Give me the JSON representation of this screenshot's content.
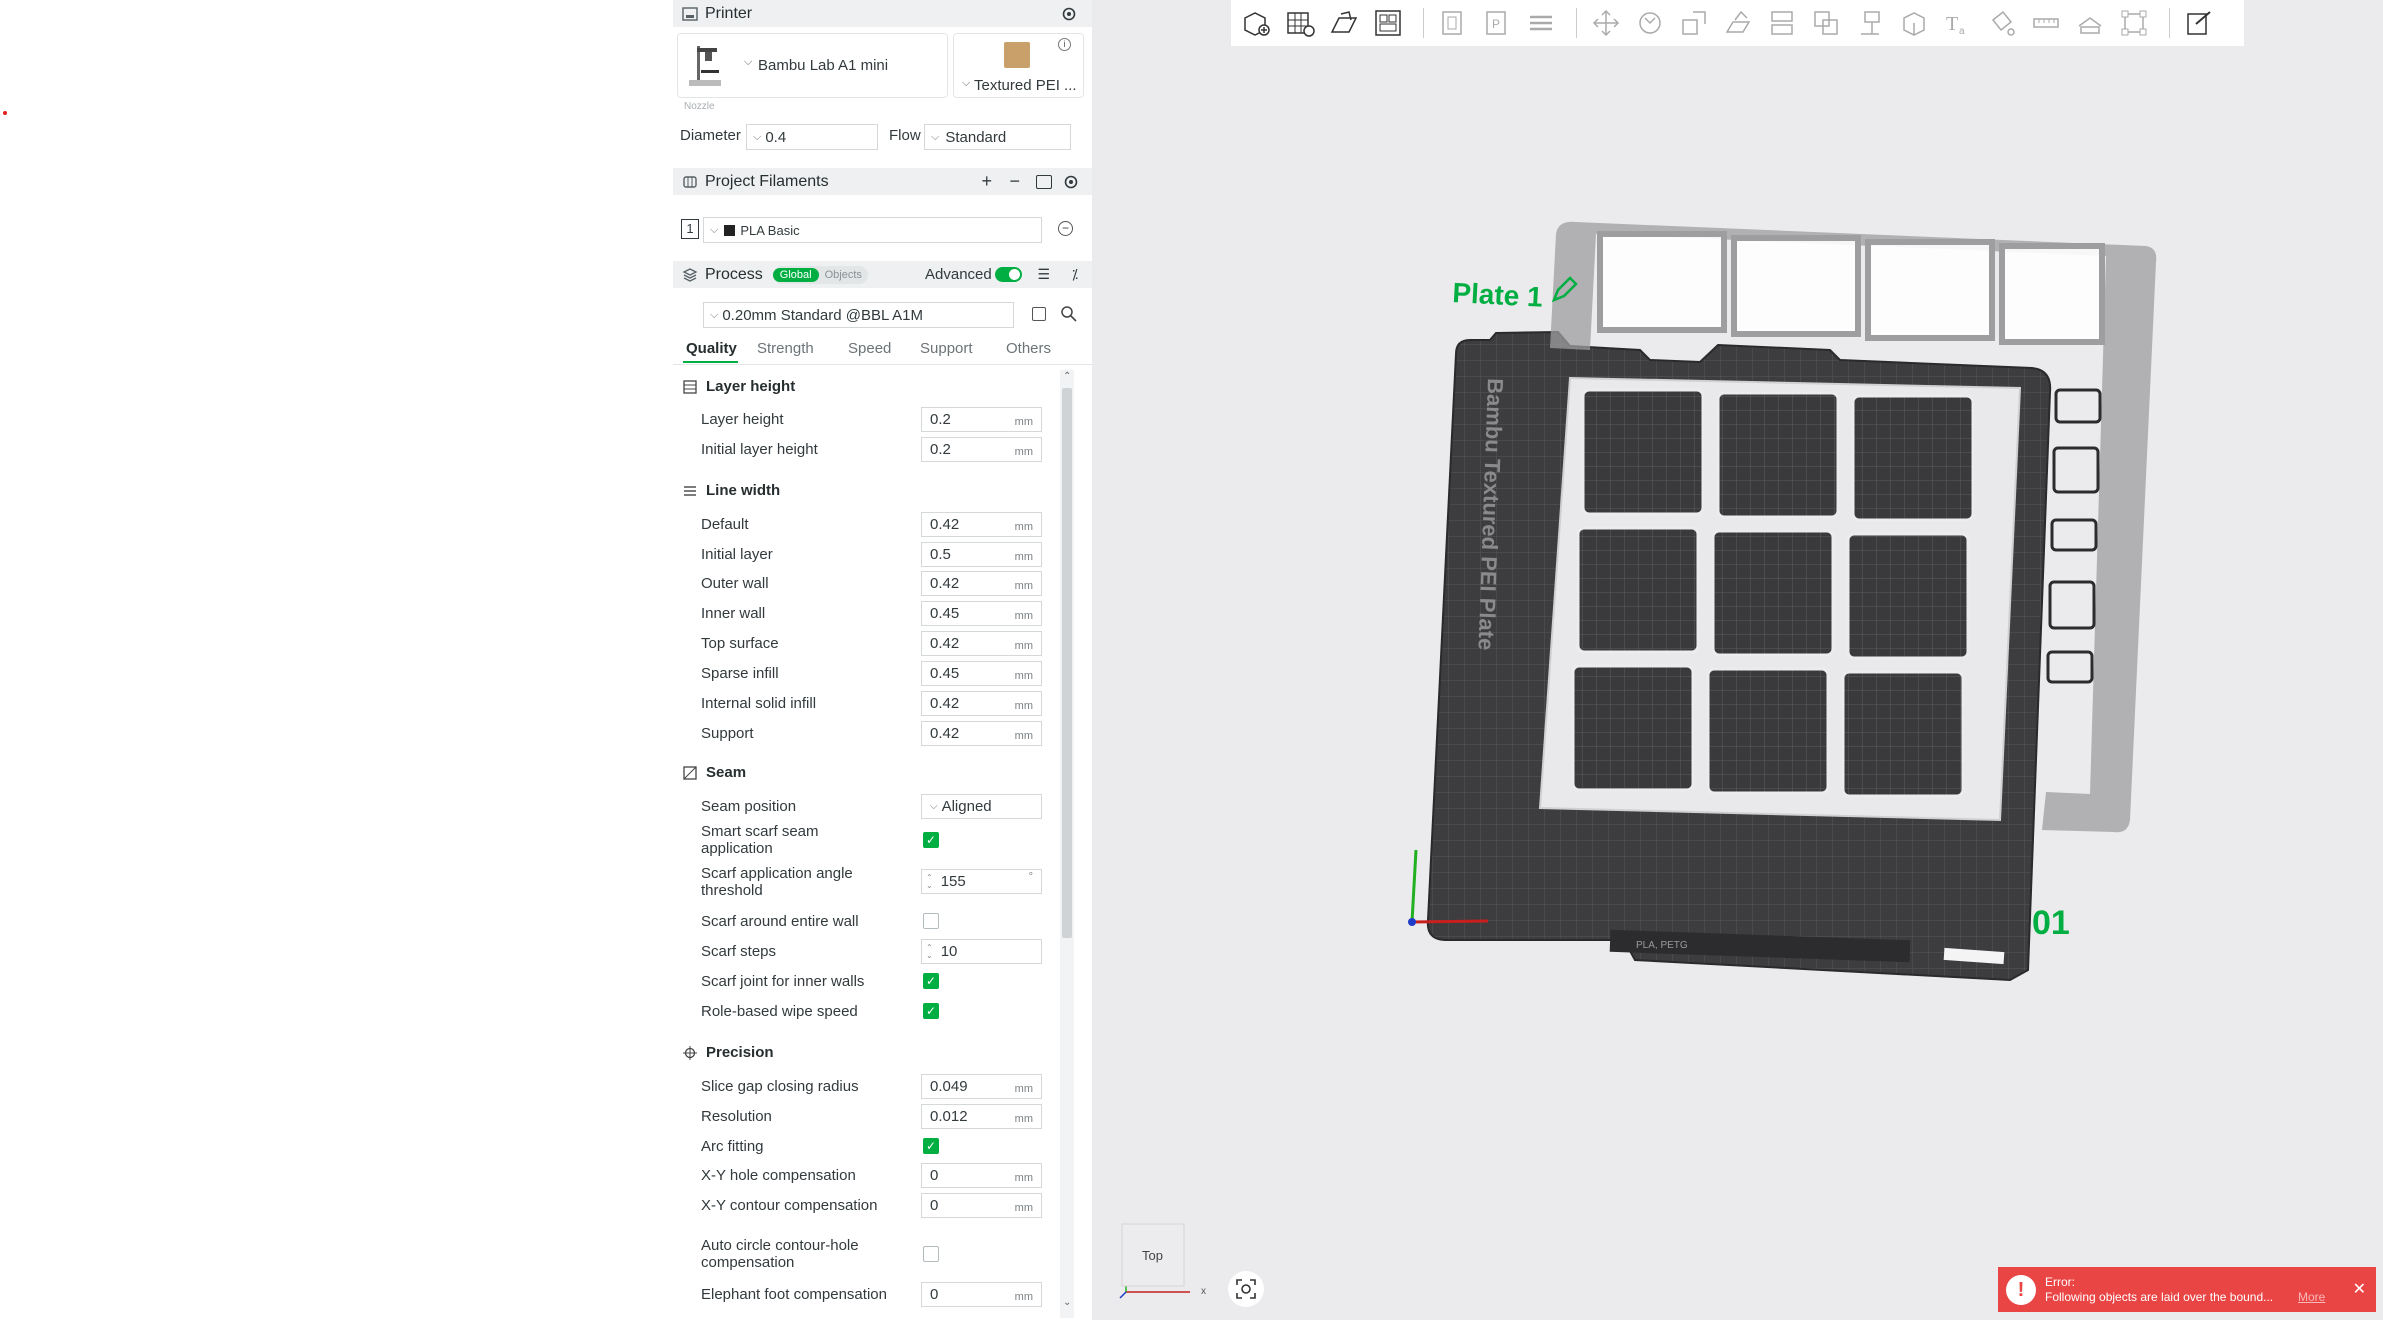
{
  "printer": {
    "title": "Printer",
    "name": "Bambu Lab A1 mini",
    "plate": "Textured PEI ...",
    "nozzle_label": "Nozzle",
    "diameter_label": "Diameter",
    "diameter_value": "0.4",
    "flow_label": "Flow",
    "flow_value": "Standard"
  },
  "filaments": {
    "title": "Project Filaments",
    "slot": "1",
    "name": "PLA Basic"
  },
  "process": {
    "title": "Process",
    "global": "Global",
    "objects": "Objects",
    "advanced": "Advanced",
    "preset": "0.20mm Standard @BBL A1M"
  },
  "tabs": [
    "Quality",
    "Strength",
    "Speed",
    "Support",
    "Others"
  ],
  "groups": {
    "layer_height": "Layer height",
    "line_width": "Line width",
    "seam": "Seam",
    "precision": "Precision"
  },
  "unit": "mm",
  "layer": [
    {
      "label": "Layer height",
      "value": "0.2"
    },
    {
      "label": "Initial layer height",
      "value": "0.2"
    }
  ],
  "linewidth": [
    {
      "label": "Default",
      "value": "0.42"
    },
    {
      "label": "Initial layer",
      "value": "0.5"
    },
    {
      "label": "Outer wall",
      "value": "0.42"
    },
    {
      "label": "Inner wall",
      "value": "0.45"
    },
    {
      "label": "Top surface",
      "value": "0.42"
    },
    {
      "label": "Sparse infill",
      "value": "0.45"
    },
    {
      "label": "Internal solid infill",
      "value": "0.42"
    },
    {
      "label": "Support",
      "value": "0.42"
    }
  ],
  "seam": {
    "position_label": "Seam position",
    "position_value": "Aligned",
    "smart_label": "Smart scarf seam application",
    "angle_label": "Scarf application angle threshold",
    "angle_value": "155",
    "angle_unit": "°",
    "entire_label": "Scarf around entire wall",
    "steps_label": "Scarf steps",
    "steps_value": "10",
    "inner_label": "Scarf joint for inner walls",
    "wipe_label": "Role-based wipe speed"
  },
  "precision": {
    "gap_label": "Slice gap closing radius",
    "gap_value": "0.049",
    "res_label": "Resolution",
    "res_value": "0.012",
    "arc_label": "Arc fitting",
    "xyhole_label": "X-Y hole compensation",
    "xyhole_value": "0",
    "xycont_label": "X-Y contour compensation",
    "xycont_value": "0",
    "auto_label": "Auto circle contour-hole compensation",
    "elephant_label": "Elephant foot compensation",
    "elephant_value": "0"
  },
  "viewport": {
    "plate_label": "Plate 1",
    "plate_bed_text": "Bambu Textured PEI Plate",
    "plate_number": "01",
    "cube_label": "Top",
    "axis_x": "x",
    "bed_strip_text": "PLA, PETG"
  },
  "error": {
    "title": "Error:",
    "message": "Following objects are laid over the bound...",
    "more": "More"
  },
  "colors": {
    "accent": "#00ae42",
    "error": "#ea4545"
  }
}
